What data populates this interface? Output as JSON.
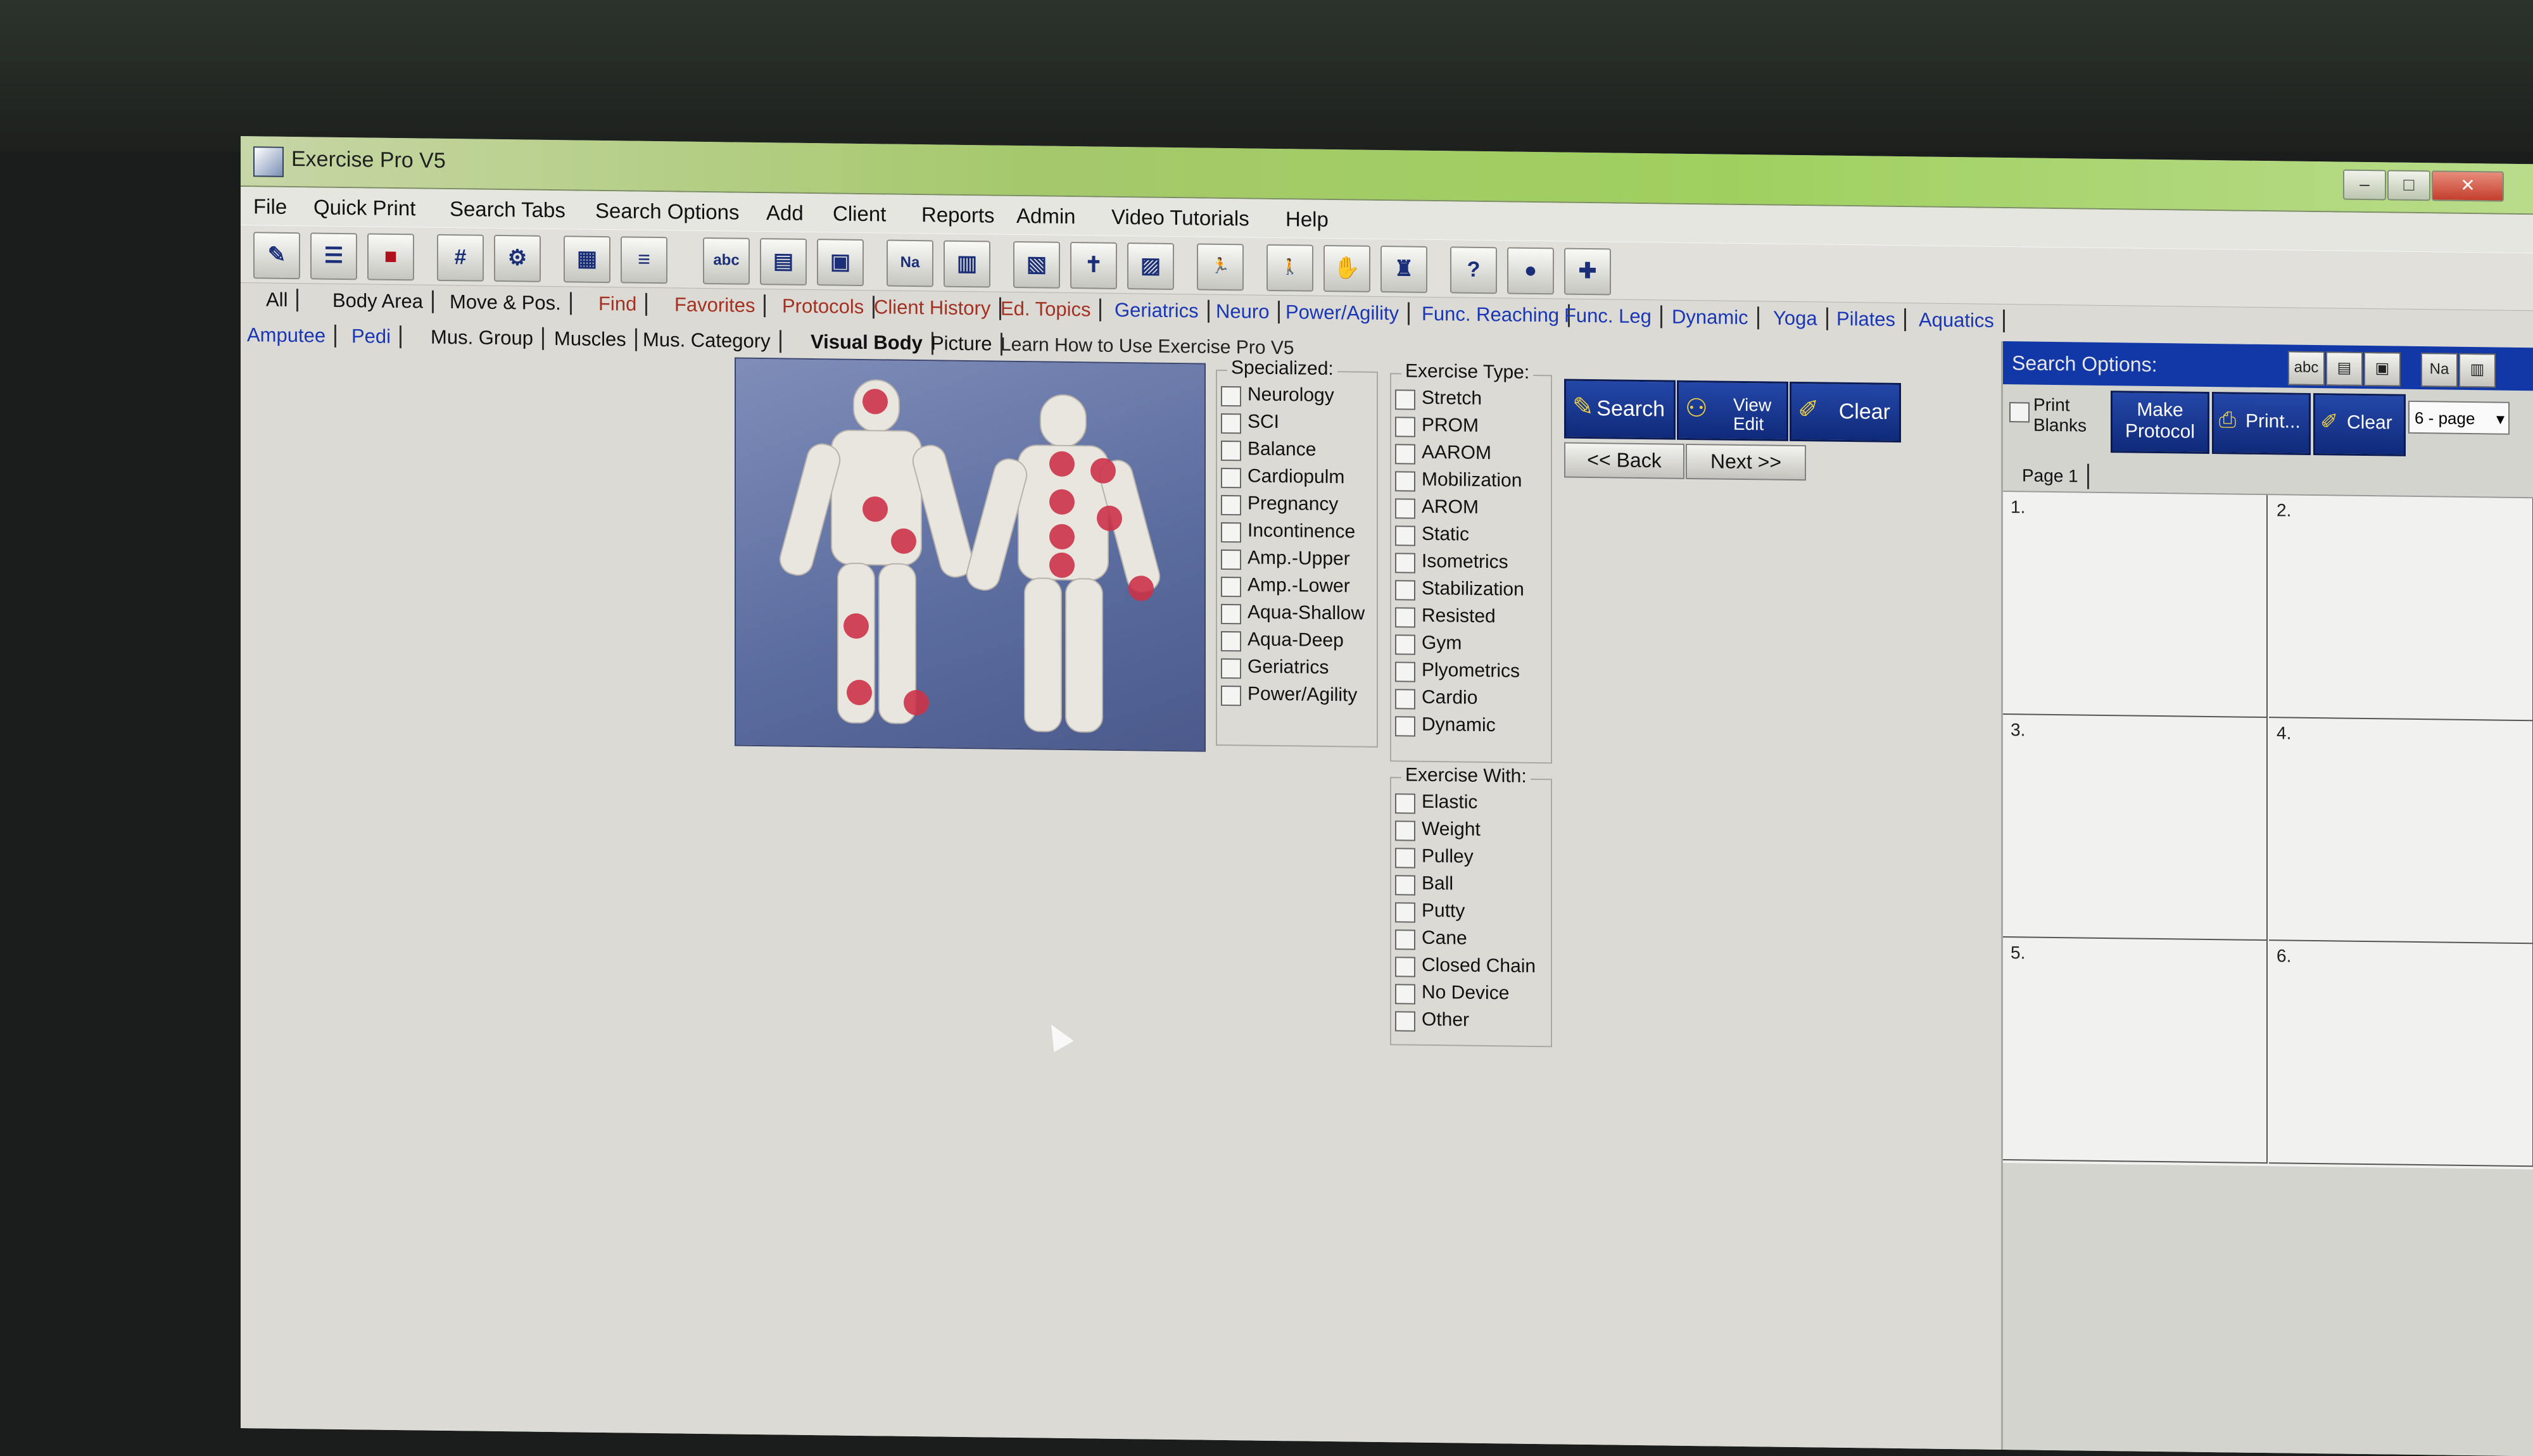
{
  "window": {
    "title": "Exercise Pro V5"
  },
  "menu": [
    "File",
    "Quick Print",
    "Search Tabs",
    "Search Options",
    "Add",
    "Client",
    "Reports",
    "Admin",
    "Video Tutorials",
    "Help"
  ],
  "toolbar": {
    "glyphs": [
      "✎",
      "☰",
      "■",
      "#",
      "⚙",
      "▦",
      "≡",
      "abc",
      "▤",
      "▣",
      "Na",
      "▥",
      "▧",
      "✝",
      "▨",
      "🏃",
      "🚶",
      "✋",
      "♜",
      "?",
      "●",
      "✚"
    ]
  },
  "tabs_row1": [
    {
      "label": "All",
      "color": "black"
    },
    {
      "label": "Body Area",
      "color": "black"
    },
    {
      "label": "Move & Pos.",
      "color": "black"
    },
    {
      "label": "Find",
      "color": "red"
    },
    {
      "label": "Favorites",
      "color": "red"
    },
    {
      "label": "Protocols",
      "color": "red"
    },
    {
      "label": "Client History",
      "color": "red"
    },
    {
      "label": "Ed. Topics",
      "color": "red"
    },
    {
      "label": "Geriatrics",
      "color": "blue"
    },
    {
      "label": "Neuro",
      "color": "blue"
    },
    {
      "label": "Power/Agility",
      "color": "blue"
    },
    {
      "label": "Func. Reaching",
      "color": "blue"
    },
    {
      "label": "Func. Leg",
      "color": "blue"
    },
    {
      "label": "Dynamic",
      "color": "blue"
    },
    {
      "label": "Yoga",
      "color": "blue"
    },
    {
      "label": "Pilates",
      "color": "blue"
    },
    {
      "label": "Aquatics",
      "color": "blue"
    }
  ],
  "tabs_row2": [
    {
      "label": "Amputee",
      "color": "blue"
    },
    {
      "label": "Pedi",
      "color": "blue"
    },
    {
      "label": "Mus. Group",
      "color": "black"
    },
    {
      "label": "Muscles",
      "color": "black"
    },
    {
      "label": "Mus. Category",
      "color": "black"
    },
    {
      "label": "Visual Body",
      "color": "active"
    },
    {
      "label": "Picture",
      "color": "black"
    }
  ],
  "learn_link": "Learn How to Use Exercise Pro V5",
  "specialized": {
    "title": "Specialized:",
    "items": [
      "Neurology",
      "SCI",
      "Balance",
      "Cardiopulm",
      "Pregnancy",
      "Incontinence",
      "Amp.-Upper",
      "Amp.-Lower",
      "Aqua-Shallow",
      "Aqua-Deep",
      "Geriatrics",
      "Power/Agility"
    ]
  },
  "exercise_type": {
    "title": "Exercise Type:",
    "items": [
      "Stretch",
      "PROM",
      "AAROM",
      "Mobilization",
      "AROM",
      "Static",
      "Isometrics",
      "Stabilization",
      "Resisted",
      "Gym",
      "Plyometrics",
      "Cardio",
      "Dynamic"
    ]
  },
  "exercise_with": {
    "title": "Exercise With:",
    "items": [
      "Elastic",
      "Weight",
      "Pulley",
      "Ball",
      "Putty",
      "Cane",
      "Closed Chain",
      "No Device",
      "Other"
    ]
  },
  "actions": {
    "search": "Search",
    "view_edit": "View Edit",
    "clear": "Clear",
    "back": "<< Back",
    "next": "Next >>"
  },
  "right_panel": {
    "title": "Search Options:",
    "option_buttons": [
      "abc",
      "▤",
      "▣",
      "Na",
      "▥"
    ],
    "print_blanks": "Print Blanks",
    "make_protocol": "Make Protocol",
    "print": "Print...",
    "clear": "Clear",
    "page_layout": "6 - page",
    "page_tab": "Page 1",
    "cells": [
      "1.",
      "2.",
      "3.",
      "4.",
      "5.",
      "6."
    ]
  }
}
